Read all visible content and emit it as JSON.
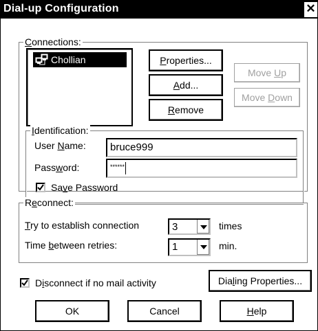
{
  "window": {
    "title": "Dial-up Configuration",
    "close_glyph": "✕"
  },
  "connections": {
    "group_label": "Connections:",
    "items": [
      {
        "label": "Chollian",
        "icon": "network-connection-icon",
        "selected": true
      }
    ],
    "buttons": {
      "properties": "Properties...",
      "add": "Add...",
      "remove": "Remove",
      "move_up": "Move Up",
      "move_down": "Move Down"
    }
  },
  "identification": {
    "group_label": "Identification:",
    "user_name_label": "User Name:",
    "user_name_value": "bruce999",
    "password_label": "Password:",
    "password_value": "******",
    "save_password_label": "Save Password",
    "save_password_checked": true
  },
  "reconnect": {
    "group_label": "Reconnect:",
    "try_label": "Try to establish connection",
    "try_value": "3",
    "try_unit": "times",
    "time_label": "Time between retries:",
    "time_value": "1",
    "time_unit": "min."
  },
  "footer": {
    "disconnect_label": "Disconnect if no mail activity",
    "disconnect_checked": true,
    "dialing_properties": "Dialing Properties...",
    "ok": "OK",
    "cancel": "Cancel",
    "help": "Help"
  },
  "colors": {
    "titlebar": "#000000",
    "selection": "#000000",
    "disabled_text": "#a0a0a0"
  }
}
